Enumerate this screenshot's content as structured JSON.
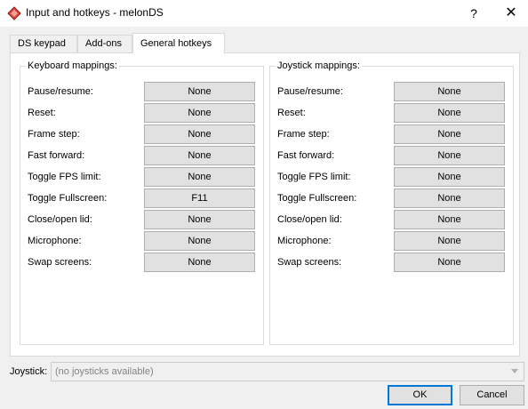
{
  "window": {
    "title": "Input and hotkeys - melonDS",
    "help_glyph": "?",
    "close_glyph": "✕",
    "app_icon": "melonds-diamond-icon",
    "accent": "#e0473b"
  },
  "tabs": [
    {
      "label": "DS keypad",
      "active": false
    },
    {
      "label": "Add-ons",
      "active": false
    },
    {
      "label": "General hotkeys",
      "active": true
    }
  ],
  "keyboard": {
    "title": "Keyboard mappings:",
    "rows": [
      {
        "label": "Pause/resume:",
        "value": "None"
      },
      {
        "label": "Reset:",
        "value": "None"
      },
      {
        "label": "Frame step:",
        "value": "None"
      },
      {
        "label": "Fast forward:",
        "value": "None"
      },
      {
        "label": "Toggle FPS limit:",
        "value": "None"
      },
      {
        "label": "Toggle Fullscreen:",
        "value": "F11"
      },
      {
        "label": "Close/open lid:",
        "value": "None"
      },
      {
        "label": "Microphone:",
        "value": "None"
      },
      {
        "label": "Swap screens:",
        "value": "None"
      }
    ]
  },
  "joystick_map": {
    "title": "Joystick mappings:",
    "rows": [
      {
        "label": "Pause/resume:",
        "value": "None"
      },
      {
        "label": "Reset:",
        "value": "None"
      },
      {
        "label": "Frame step:",
        "value": "None"
      },
      {
        "label": "Fast forward:",
        "value": "None"
      },
      {
        "label": "Toggle FPS limit:",
        "value": "None"
      },
      {
        "label": "Toggle Fullscreen:",
        "value": "None"
      },
      {
        "label": "Close/open lid:",
        "value": "None"
      },
      {
        "label": "Microphone:",
        "value": "None"
      },
      {
        "label": "Swap screens:",
        "value": "None"
      }
    ]
  },
  "joystick": {
    "label": "Joystick:",
    "selected": "(no joysticks available)"
  },
  "buttons": {
    "ok": "OK",
    "cancel": "Cancel"
  }
}
